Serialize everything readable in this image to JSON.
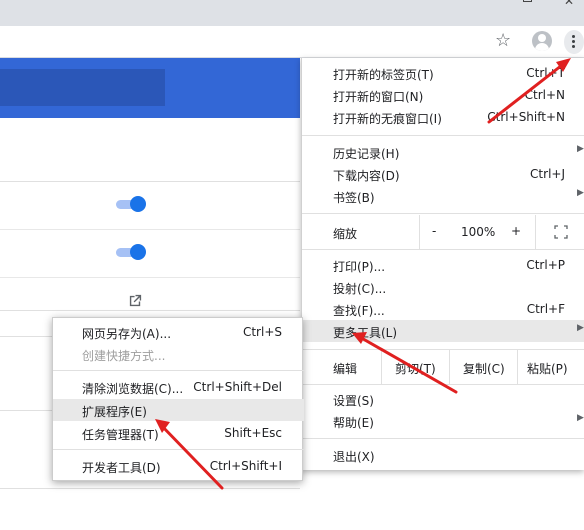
{
  "toolbar": {
    "star_icon": "star-icon",
    "profile_icon": "profile-avatar-icon",
    "menu_icon": "more-vert-icon"
  },
  "menu": {
    "new_tab": {
      "label": "打开新的标签页(T)",
      "shortcut": "Ctrl+T"
    },
    "new_window": {
      "label": "打开新的窗口(N)",
      "shortcut": "Ctrl+N"
    },
    "incognito": {
      "label": "打开新的无痕窗口(I)",
      "shortcut": "Ctrl+Shift+N"
    },
    "history": {
      "label": "历史记录(H)"
    },
    "downloads": {
      "label": "下载内容(D)",
      "shortcut": "Ctrl+J"
    },
    "bookmarks": {
      "label": "书签(B)"
    },
    "zoom": {
      "label": "缩放",
      "minus": "-",
      "value": "100%",
      "plus": "+"
    },
    "print": {
      "label": "打印(P)...",
      "shortcut": "Ctrl+P"
    },
    "cast": {
      "label": "投射(C)..."
    },
    "find": {
      "label": "查找(F)...",
      "shortcut": "Ctrl+F"
    },
    "more_tools": {
      "label": "更多工具(L)"
    },
    "edit": {
      "label": "编辑",
      "cut": "剪切(T)",
      "copy": "复制(C)",
      "paste": "粘贴(P)"
    },
    "settings": {
      "label": "设置(S)"
    },
    "help": {
      "label": "帮助(E)"
    },
    "exit": {
      "label": "退出(X)"
    }
  },
  "submenu": {
    "save_page": {
      "label": "网页另存为(A)...",
      "shortcut": "Ctrl+S"
    },
    "create_shortcut": {
      "label": "创建快捷方式..."
    },
    "clear_data": {
      "label": "清除浏览数据(C)...",
      "shortcut": "Ctrl+Shift+Del"
    },
    "extensions": {
      "label": "扩展程序(E)"
    },
    "task_manager": {
      "label": "任务管理器(T)",
      "shortcut": "Shift+Esc"
    },
    "dev_tools": {
      "label": "开发者工具(D)",
      "shortcut": "Ctrl+Shift+I"
    }
  },
  "colors": {
    "banner": "#3367d6",
    "toggle_on": "#1a73e8",
    "highlight": "#e8e8e8",
    "annotation_arrow": "#e02020"
  }
}
